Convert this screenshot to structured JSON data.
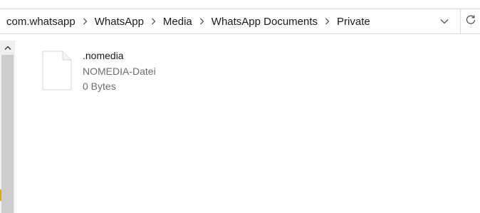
{
  "breadcrumb": {
    "items": [
      "com.whatsapp",
      "WhatsApp",
      "Media",
      "WhatsApp Documents",
      "Private"
    ]
  },
  "icons": {
    "separator": "chevron-right-icon",
    "dropdown": "chevron-down-icon",
    "refresh": "refresh-icon",
    "scroll_up": "chevron-up-icon",
    "file": "document-icon"
  },
  "file": {
    "name": ".nomedia",
    "type": "NOMEDIA-Datei",
    "size": "0 Bytes"
  },
  "colors": {
    "secondary_text": "#6d6d6d",
    "scrollbar_track": "#f0f0f0",
    "scrollbar_thumb": "#cdcdcd"
  }
}
